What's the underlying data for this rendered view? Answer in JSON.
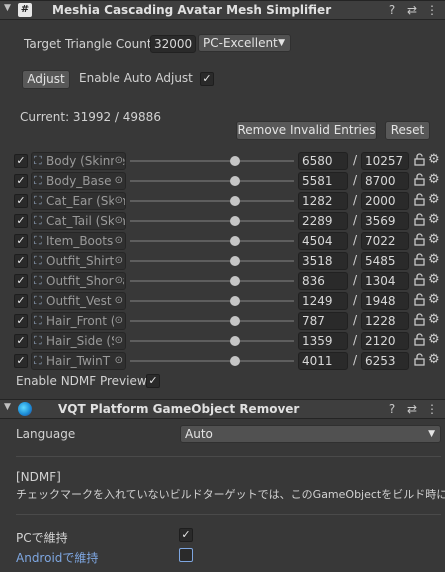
{
  "mesh_simplifier": {
    "title": "Meshia Cascading Avatar Mesh Simplifier",
    "target_label": "Target Triangle Count",
    "target_value": "32000",
    "preset": "PC-Excellent",
    "adjust_label": "Adjust",
    "auto_adjust_label": "Enable Auto Adjust",
    "auto_adjust_checked": true,
    "current_text": "Current: 31992 / 49886",
    "remove_invalid_label": "Remove Invalid Entries",
    "reset_label": "Reset",
    "rows": [
      {
        "name": "Body (Skinned",
        "value": "6580",
        "max": "10257",
        "fraction": 0.641
      },
      {
        "name": "Body_Base",
        "value": "5581",
        "max": "8700",
        "fraction": 0.641
      },
      {
        "name": "Cat_Ear (Skin",
        "value": "1282",
        "max": "2000",
        "fraction": 0.641
      },
      {
        "name": "Cat_Tail (Skin",
        "value": "2289",
        "max": "3569",
        "fraction": 0.641
      },
      {
        "name": "Item_Boots",
        "value": "4504",
        "max": "7022",
        "fraction": 0.641
      },
      {
        "name": "Outfit_Shirt",
        "value": "3518",
        "max": "5485",
        "fraction": 0.641
      },
      {
        "name": "Outfit_Shorts",
        "value": "836",
        "max": "1304",
        "fraction": 0.641
      },
      {
        "name": "Outfit_Vest",
        "value": "1249",
        "max": "1948",
        "fraction": 0.641
      },
      {
        "name": "Hair_Front (",
        "value": "787",
        "max": "1228",
        "fraction": 0.641
      },
      {
        "name": "Hair_Side (S",
        "value": "1359",
        "max": "2120",
        "fraction": 0.641
      },
      {
        "name": "Hair_TwinT",
        "value": "4011",
        "max": "6253",
        "fraction": 0.641
      }
    ],
    "ndmf_preview_label": "Enable NDMF Preview",
    "ndmf_preview_checked": true
  },
  "remover": {
    "title": "VQT Platform GameObject Remover",
    "language_label": "Language",
    "language_value": "Auto",
    "ndmf_tag": "[NDMF]",
    "description": "チェックマークを入れていないビルドターゲットでは、このGameObjectをビルド時に削除します。",
    "pc_keep_label": "PCで維持",
    "pc_keep_checked": true,
    "android_keep_label": "Androidで維持",
    "android_keep_checked": false
  },
  "icons": {
    "help": "?",
    "settings": "⇄",
    "menu": "⋮",
    "check": "✓",
    "lock": "🔓",
    "gear": "⚙",
    "mesh": "⛶",
    "dot": "⊙",
    "arrow": "▼",
    "fold": "▼",
    "script": "#"
  },
  "colors": {
    "background": "#383838",
    "header": "#3e3e3e",
    "accent_blue": "#7ea6e0"
  }
}
